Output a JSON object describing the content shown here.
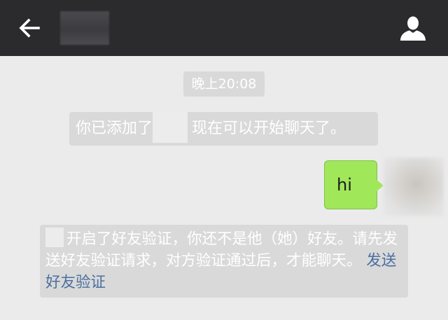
{
  "header": {
    "back_icon": "back-arrow-icon",
    "profile_icon": "person-icon",
    "colors": {
      "bar": "#2b2b2e",
      "icon": "#ffffff"
    }
  },
  "chat": {
    "timestamp": "晚上20:08",
    "added_notice": {
      "prefix": "你已添加了",
      "suffix": "现在可以开始聊天了。"
    },
    "messages": [
      {
        "sender": "me",
        "text": "hi"
      }
    ],
    "verification_notice": {
      "text": "开启了好友验证，你还不是他（她）好友。请先发送好友验证请求，对方验证通过后，才能聊天。",
      "link": "发送好友验证"
    },
    "colors": {
      "background": "#ebebeb",
      "system_pill": "#d9d9d9",
      "my_bubble": "#a0e75a",
      "link": "#4b6fa0"
    }
  }
}
